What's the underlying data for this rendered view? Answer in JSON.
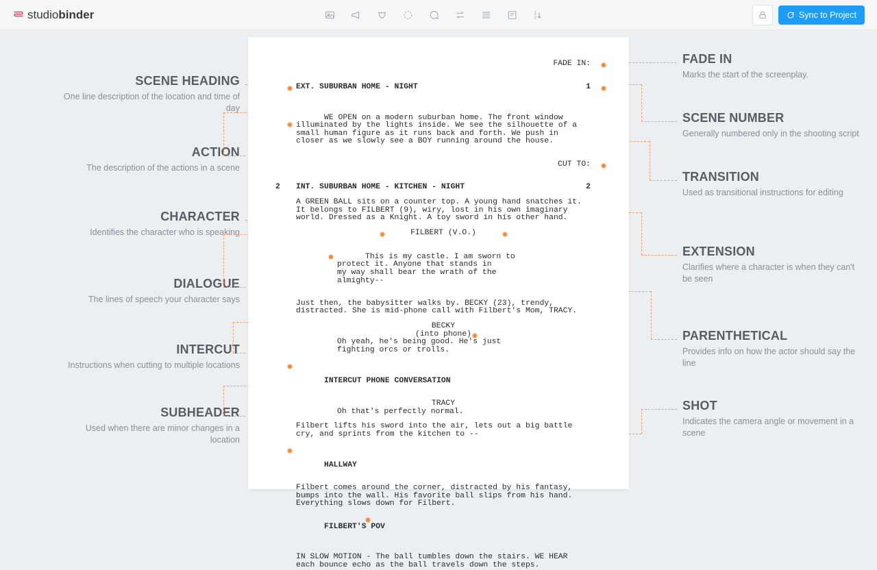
{
  "brand": {
    "name1": "studio",
    "name2": "binder"
  },
  "toolbar": {
    "sync_label": "Sync to Project"
  },
  "script": {
    "fade_in": "FADE IN:",
    "s1_num": "1",
    "s1_heading": "EXT. SUBURBAN HOME - NIGHT",
    "s1_action": "WE OPEN on a modern suburban home. The front window illuminated by the lights inside. We see the silhouette of a small human figure as it runs back and forth. We push in closer as we slowly see a BOY running around the house.",
    "cut_to": "CUT TO:",
    "s2_num_l": "2",
    "s2_num_r": "2",
    "s2_heading": "INT. SUBURBAN HOME - KITCHEN - NIGHT",
    "s2_action": "A GREEN BALL sits on a counter top. A young hand snatches it. It belongs to FILBERT (9), wiry, lost in his own imaginary world. Dressed as a Knight. A toy sword in his other hand.",
    "char_filbert": "FILBERT (V.O.)",
    "dlg_filbert": "This is my castle. I am sworn to\nprotect it. Anyone that stands in\nmy way shall bear the wrath of the\nalmighty--",
    "s2_action2": "Just then, the babysitter walks by. BECKY (23), trendy, distracted. She is mid-phone call with Filbert's Mom, TRACY.",
    "char_becky": "BECKY",
    "paren_becky": "(into phone)",
    "dlg_becky": "Oh yeah, he's being good. He's just\nfighting orcs or trolls.",
    "intercut": "INTERCUT PHONE CONVERSATION",
    "char_tracy": "TRACY",
    "dlg_tracy": "Oh that's perfectly normal.",
    "s2_action3": "Filbert lifts his sword into the air, lets out a big battle cry, and sprints from the kitchen to --",
    "sub_hallway": "HALLWAY",
    "hall_action": "Filbert comes around the corner, distracted by his fantasy, bumps into the wall. His favorite ball slips from his hand. Everything slows down for Filbert.",
    "shot": "FILBERT'S POV",
    "shot_action": "IN SLOW MOTION - The ball tumbles down the stairs. WE HEAR each bounce echo as the ball travels down the steps."
  },
  "ann_left": {
    "scene_heading_t": "SCENE HEADING",
    "scene_heading_d": "One line description of the location and time of day",
    "action_t": "ACTION",
    "action_d": "The description of the actions in a scene",
    "character_t": "CHARACTER",
    "character_d": "Identifies the character who is speaking",
    "dialogue_t": "DIALOGUE",
    "dialogue_d": "The lines of speech your character says",
    "intercut_t": "INTERCUT",
    "intercut_d": "Instructions when cutting to multiple locations",
    "subheader_t": "SUBHEADER",
    "subheader_d": "Used when there are minor changes in a location"
  },
  "ann_right": {
    "fadein_t": "FADE IN",
    "fadein_d": "Marks the start of the screenplay.",
    "scenenum_t": "SCENE NUMBER",
    "scenenum_d": "Generally numbered only in the shooting script",
    "transition_t": "TRANSITION",
    "transition_d": "Used as transitional instructions for editing",
    "extension_t": "EXTENSION",
    "extension_d": "Clarifies where a character is when they can't be seen",
    "parenthetical_t": "PARENTHETICAL",
    "parenthetical_d": "Provides info on how the actor should say the line",
    "shot_t": "SHOT",
    "shot_d": "Indicates the camera angle or movement in a scene"
  }
}
